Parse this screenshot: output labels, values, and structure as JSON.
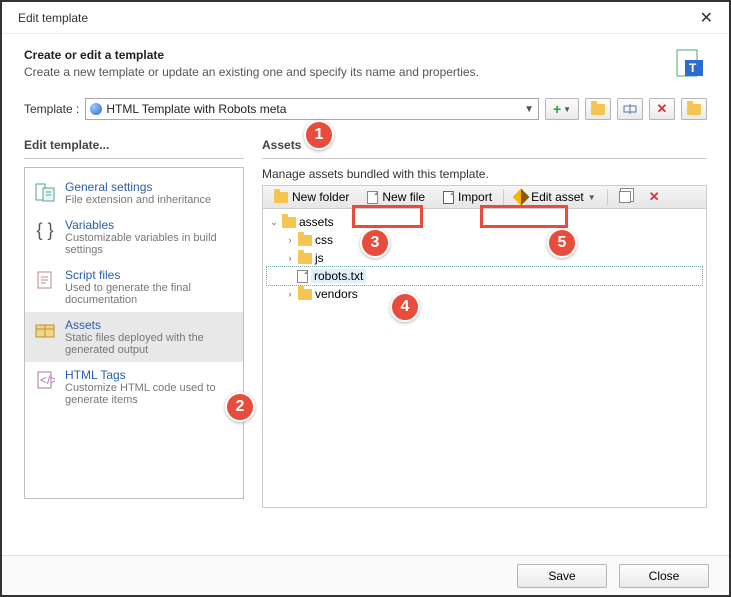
{
  "window": {
    "title": "Edit template"
  },
  "header": {
    "title": "Create or edit a template",
    "subtitle": "Create a new template or update an existing one and specify its name and properties."
  },
  "template_row": {
    "label": "Template :",
    "value": "HTML Template with Robots meta"
  },
  "left": {
    "section_title": "Edit template...",
    "items": [
      {
        "title": "General settings",
        "sub": "File extension and inheritance"
      },
      {
        "title": "Variables",
        "sub": "Customizable variables in build settings"
      },
      {
        "title": "Script files",
        "sub": "Used to generate the final documentation"
      },
      {
        "title": "Assets",
        "sub": "Static files deployed with the generated output"
      },
      {
        "title": "HTML Tags",
        "sub": "Customize HTML code used to generate items"
      }
    ]
  },
  "right": {
    "section_title": "Assets",
    "description": "Manage assets bundled with this template.",
    "toolbar": {
      "new_folder": "New folder",
      "new_file": "New file",
      "import": "Import",
      "edit_asset": "Edit asset"
    },
    "tree": {
      "root": "assets",
      "children": [
        "css",
        "js",
        "robots.txt",
        "vendors"
      ]
    }
  },
  "footer": {
    "save": "Save",
    "close": "Close"
  },
  "callouts": {
    "1": "1",
    "2": "2",
    "3": "3",
    "4": "4",
    "5": "5"
  }
}
